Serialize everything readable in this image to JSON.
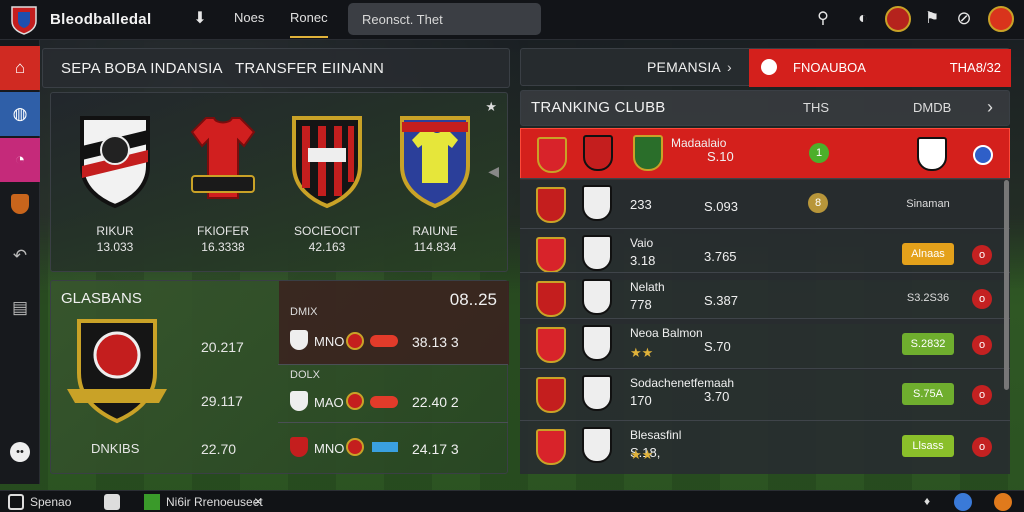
{
  "app": {
    "title": "Bleodballedal"
  },
  "topbar": {
    "tabs": [
      "Noes",
      "Ronec"
    ],
    "search_placeholder": "Reonsct. Thet"
  },
  "left_panel": {
    "header_left": "SEPA BOBA INDANSIA",
    "header_right": "TRANSFER EIINANN",
    "cards": [
      {
        "name": "RIKUR",
        "value": "13.033"
      },
      {
        "name": "FKIOFER",
        "value": "16.3338"
      },
      {
        "name": "SOCIEOCIT",
        "value": "42.163"
      },
      {
        "name": "RAIUNE",
        "value": "114.834"
      }
    ]
  },
  "stats_panel": {
    "title": "GLASBANS",
    "right_value": "08..25",
    "left_values": [
      "20.217",
      "29.117",
      "22.70"
    ],
    "left_label": "DNKIBS",
    "rows": [
      {
        "tag": "DMIX",
        "label": "MNO",
        "value": "38.13 3"
      },
      {
        "tag": "DOLX",
        "label": "MAO",
        "value": "22.40 2"
      },
      {
        "tag": "",
        "label": "MNO",
        "value": "24.17 3"
      }
    ]
  },
  "right_panel": {
    "tab_left": "PEMANSIA",
    "tab_right": "FNOAUBOA",
    "tab_right_value": "THA8/32",
    "title": "TRANKING CLUBB",
    "col1": "THS",
    "col2": "DMDB",
    "rows": [
      {
        "name": "Madaalaio",
        "a": "",
        "b": "S.10",
        "badge": "1",
        "badge_color": "#4caf2a",
        "chip": "",
        "highlight": true,
        "stars": ""
      },
      {
        "name": "",
        "a": "233",
        "b": "S.093",
        "badge": "8",
        "badge_color": "#b8963a",
        "chip": "Sinaman",
        "highlight": false,
        "stars": ""
      },
      {
        "name": "Vaio",
        "a": "3.18",
        "b": "3.765",
        "badge": "",
        "badge_color": "",
        "chip": "Alnaas",
        "highlight": false,
        "stars": ""
      },
      {
        "name": "Nelath",
        "a": "778",
        "b": "S.387",
        "badge": "",
        "badge_color": "",
        "chip": "S3.2S36",
        "highlight": false,
        "stars": ""
      },
      {
        "name": "Neoa Balmon",
        "a": "",
        "b": "S.70",
        "badge": "",
        "badge_color": "",
        "chip": "S.2832",
        "highlight": false,
        "stars": "★★"
      },
      {
        "name": "Sodachenetfemaah",
        "a": "170",
        "b": "3.70",
        "badge": "",
        "badge_color": "",
        "chip": "S.75A",
        "highlight": false,
        "stars": ""
      },
      {
        "name": "Blesasfinl",
        "a": "S.18,",
        "b": "",
        "badge": "",
        "badge_color": "",
        "chip": "Llsass",
        "highlight": false,
        "stars": "★★"
      }
    ]
  },
  "bottombar": {
    "left_label": "Spenao",
    "news_label": "Ni6ir Rrenoeuseet"
  },
  "colors": {
    "accent_red": "#d4201c",
    "gold": "#e0b23a",
    "chip_yellow": "#e4a11b",
    "chip_green": "#6fae2e"
  }
}
